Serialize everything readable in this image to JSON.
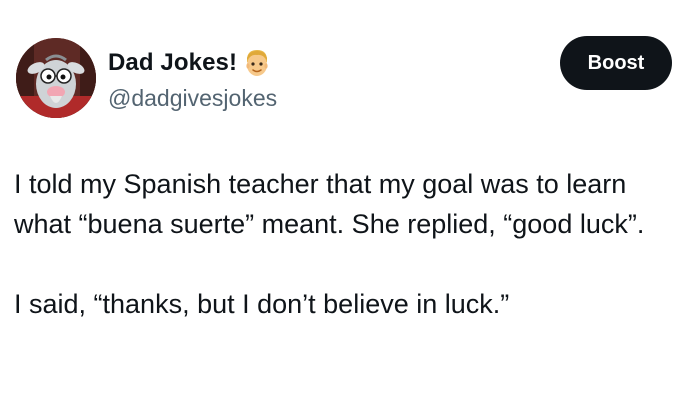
{
  "author": {
    "display_name": "Dad Jokes!",
    "badge_icon": "man-face-emoji-icon",
    "handle": "@dadgivesjokes"
  },
  "actions": {
    "boost_label": "Boost"
  },
  "tweet": {
    "paragraphs": [
      "I told my Spanish teacher that my goal was to learn what “buena suerte” meant. She replied, “good luck”.",
      "I said, “thanks, but I don’t believe in luck.”"
    ]
  },
  "colors": {
    "text": "#0f1419",
    "handle": "#536471",
    "button_bg": "#0f1419",
    "button_text": "#ffffff",
    "background": "#ffffff"
  }
}
